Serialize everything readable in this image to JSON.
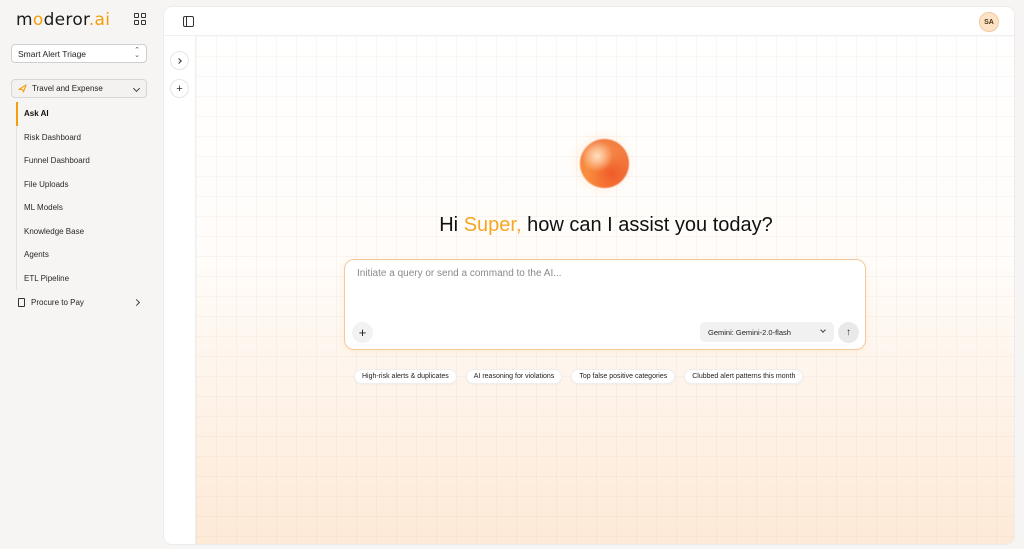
{
  "logo": {
    "prefix": "m",
    "ring": "o",
    "middle": "deror",
    "dot": ".",
    "accent": "ai"
  },
  "brand_colors": {
    "accent": "#f59e0b",
    "avatar_bg": "#fde3c6"
  },
  "workspace_select": {
    "value": "Smart Alert Triage"
  },
  "nav_group": {
    "label": "Travel and Expense",
    "icon": "plane-icon"
  },
  "nav_items": [
    {
      "label": "Ask AI",
      "active": true
    },
    {
      "label": "Risk Dashboard",
      "active": false
    },
    {
      "label": "Funnel Dashboard",
      "active": false
    },
    {
      "label": "File Uploads",
      "active": false
    },
    {
      "label": "ML Models",
      "active": false
    },
    {
      "label": "Knowledge Base",
      "active": false
    },
    {
      "label": "Agents",
      "active": false
    },
    {
      "label": "ETL Pipeline",
      "active": false
    }
  ],
  "procure": {
    "label": "Procure to Pay",
    "icon": "document-icon"
  },
  "header": {
    "avatar_initials": "SA"
  },
  "greeting": {
    "hi": "Hi ",
    "name": "Super,",
    "rest": " how can I assist you today?"
  },
  "composer": {
    "placeholder": "Initiate a query or send a command to the AI...",
    "model": "Gemini: Gemini-2.0-flash"
  },
  "suggestions": [
    "High-risk alerts & duplicates",
    "AI reasoning for violations",
    "Top false positive categories",
    "Clubbed alert patterns this month"
  ]
}
